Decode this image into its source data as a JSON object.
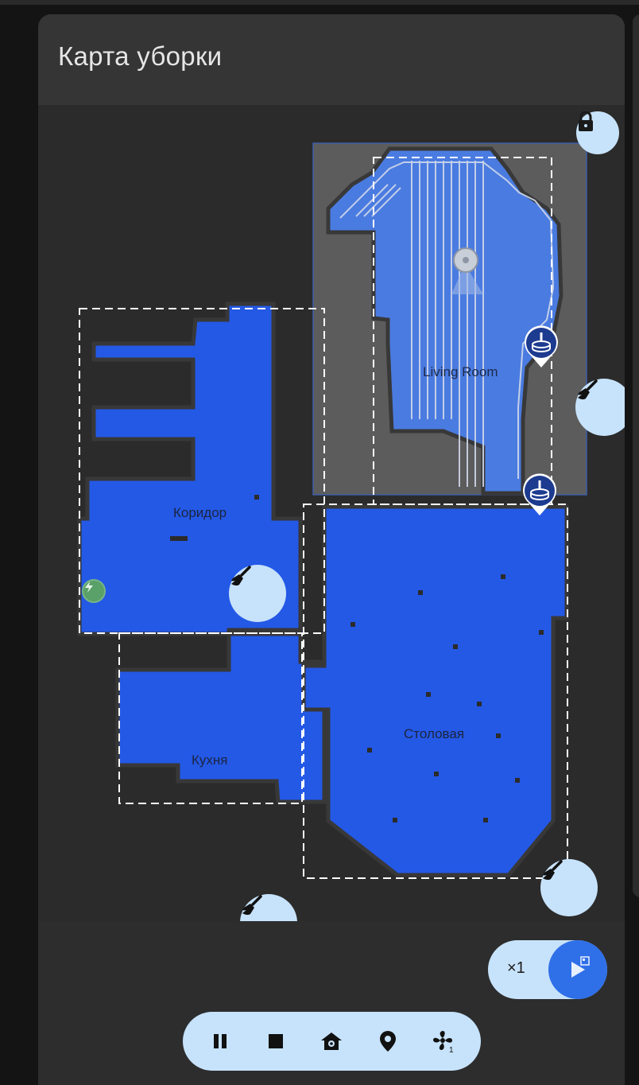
{
  "card": {
    "title": "Карта уборки"
  },
  "rooms": {
    "living": {
      "label": "Living Room"
    },
    "corridor": {
      "label": "Коридор"
    },
    "kitchen": {
      "label": "Кухня"
    },
    "dining": {
      "label": "Столовая"
    }
  },
  "map_buttons": {
    "lock_icon": "lock-icon",
    "clean_icon": "broom-icon",
    "marker_icon": "mop-marker-icon",
    "dock_icon": "charging-dock-icon"
  },
  "repeat": {
    "label": "×1"
  },
  "controls": [
    {
      "name": "pause-button",
      "icon": "pause-icon"
    },
    {
      "name": "stop-button",
      "icon": "stop-icon"
    },
    {
      "name": "return-home-button",
      "icon": "home-icon"
    },
    {
      "name": "locate-button",
      "icon": "location-pin-icon"
    },
    {
      "name": "fan-speed-button",
      "icon": "fan-icon",
      "badge": "1"
    }
  ],
  "colors": {
    "floor": "#2459e6",
    "floor_selected": "#4f7fe0",
    "selection": "#5c5c5c",
    "button_bg": "#c7e3fb",
    "accent": "#2f6fe8"
  }
}
